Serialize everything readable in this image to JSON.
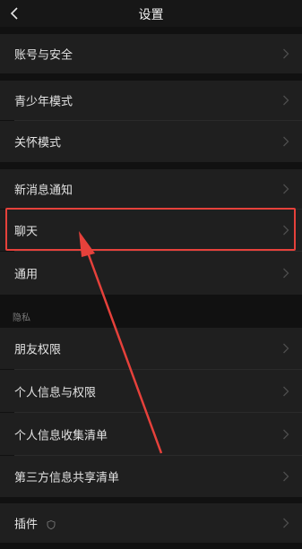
{
  "header": {
    "title": "设置",
    "back_icon": "chevron-left-icon"
  },
  "rows": {
    "account_security": "账号与安全",
    "youth_mode": "青少年模式",
    "care_mode": "关怀模式",
    "notifications": "新消息通知",
    "chat": "聊天",
    "general": "通用",
    "friend_permissions": "朋友权限",
    "personal_info_permissions": "个人信息与权限",
    "personal_info_collection": "个人信息收集清单",
    "third_party_sharing": "第三方信息共享清单",
    "plugins": "插件"
  },
  "sections": {
    "privacy": "隐私"
  },
  "annotation": {
    "highlight_color": "#e6413b",
    "arrow_color": "#e6413b"
  },
  "icons": {
    "chevron": "chevron-right-icon",
    "plugin_badge": "shield-icon"
  }
}
